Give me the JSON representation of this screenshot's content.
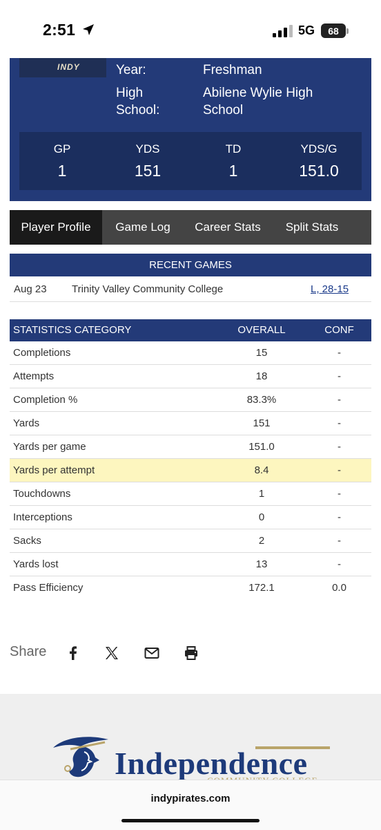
{
  "status_bar": {
    "time": "2:51",
    "network": "5G",
    "battery": "68"
  },
  "player": {
    "photo_text": "INDY",
    "info": [
      {
        "label": "Year:",
        "value": "Freshman"
      },
      {
        "label": "High School:",
        "value": "Abilene Wylie High School"
      }
    ],
    "stats": [
      {
        "label": "GP",
        "value": "1"
      },
      {
        "label": "YDS",
        "value": "151"
      },
      {
        "label": "TD",
        "value": "1"
      },
      {
        "label": "YDS/G",
        "value": "151.0"
      }
    ]
  },
  "tabs": [
    "Player Profile",
    "Game Log",
    "Career Stats",
    "Split Stats"
  ],
  "recent_games": {
    "header": "RECENT GAMES",
    "rows": [
      {
        "date": "Aug 23",
        "opponent": "Trinity Valley Community College",
        "result": "L, 28-15"
      }
    ]
  },
  "stats_table": {
    "headers": {
      "category": "STATISTICS CATEGORY",
      "overall": "OVERALL",
      "conf": "CONF"
    },
    "rows": [
      {
        "category": "Completions",
        "overall": "15",
        "conf": "-"
      },
      {
        "category": "Attempts",
        "overall": "18",
        "conf": "-"
      },
      {
        "category": "Completion %",
        "overall": "83.3%",
        "conf": "-"
      },
      {
        "category": "Yards",
        "overall": "151",
        "conf": "-"
      },
      {
        "category": "Yards per game",
        "overall": "151.0",
        "conf": "-"
      },
      {
        "category": "Yards per attempt",
        "overall": "8.4",
        "conf": "-"
      },
      {
        "category": "Touchdowns",
        "overall": "1",
        "conf": "-"
      },
      {
        "category": "Interceptions",
        "overall": "0",
        "conf": "-"
      },
      {
        "category": "Sacks",
        "overall": "2",
        "conf": "-"
      },
      {
        "category": "Yards lost",
        "overall": "13",
        "conf": "-"
      },
      {
        "category": "Pass Efficiency",
        "overall": "172.1",
        "conf": "0.0"
      }
    ],
    "highlighted_row": "Yards per attempt"
  },
  "share": {
    "label": "Share",
    "icons": [
      "facebook-icon",
      "x-icon",
      "email-icon",
      "print-icon"
    ]
  },
  "footer": {
    "logo_text": "Independence",
    "logo_subtext": "COMMUNITY COLLEGE",
    "url": "indypirates.com"
  },
  "colors": {
    "navy": "#233a78",
    "dark_navy": "#1b2e5e",
    "tab_bg": "#444444",
    "tab_active": "#1a1a1a",
    "highlight": "#fdf6bf",
    "gold": "#b9a46a"
  }
}
